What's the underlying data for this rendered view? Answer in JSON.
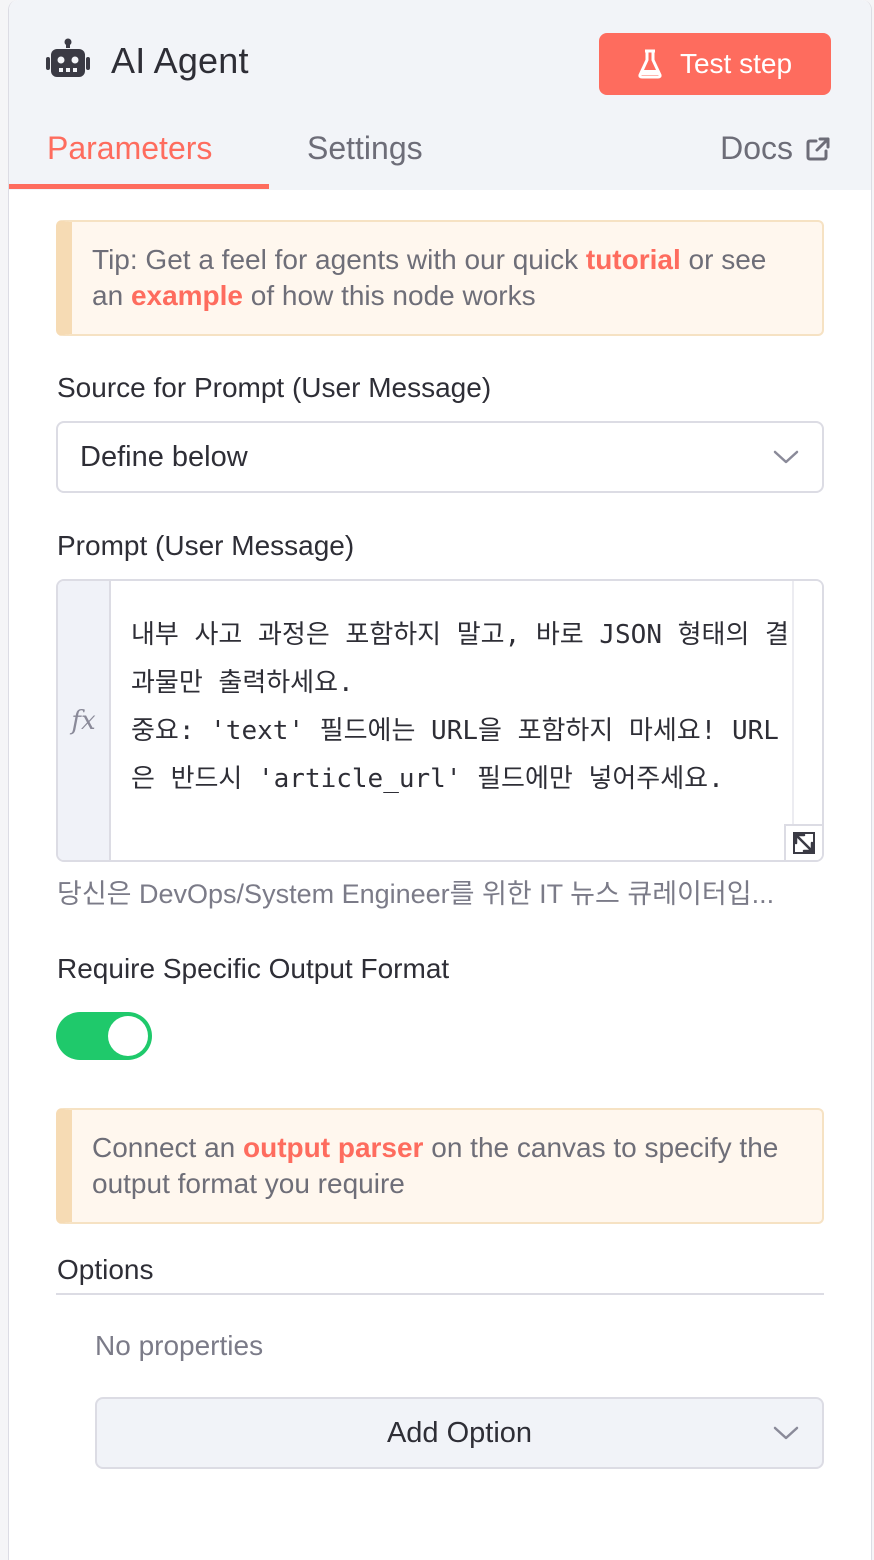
{
  "header": {
    "title": "AI Agent",
    "test_step_label": "Test step",
    "accent_color": "#fe6c5e"
  },
  "tabs": [
    {
      "label": "Parameters",
      "active": true
    },
    {
      "label": "Settings",
      "active": false
    }
  ],
  "docs_label": "Docs",
  "tip_callout": {
    "prefix": "Tip: Get a feel for agents with our quick ",
    "tutorial_link": "tutorial",
    "middle": " or see an ",
    "example_link": "example",
    "suffix": " of how this node works"
  },
  "prompt_source": {
    "label": "Source for Prompt (User Message)",
    "value": "Define below"
  },
  "prompt": {
    "label": "Prompt (User Message)",
    "fx_label": "fx",
    "text": "내부 사고 과정은 포함하지 말고, 바로 JSON 형태의 결과물만 출력하세요.\n중요: 'text' 필드에는 URL을 포함하지 마세요! URL은 반드시 'article_url' 필드에만 넣어주세요.",
    "preview": "당신은 DevOps/System Engineer를 위한 IT 뉴스 큐레이터입..."
  },
  "output_format": {
    "label": "Require Specific Output Format",
    "enabled": true,
    "toggle_color": "#1fc96b"
  },
  "parser_callout": {
    "prefix": "Connect an ",
    "link": "output parser",
    "suffix": " on the canvas to specify the output format you require"
  },
  "options": {
    "label": "Options",
    "empty_text": "No properties",
    "add_label": "Add Option"
  }
}
